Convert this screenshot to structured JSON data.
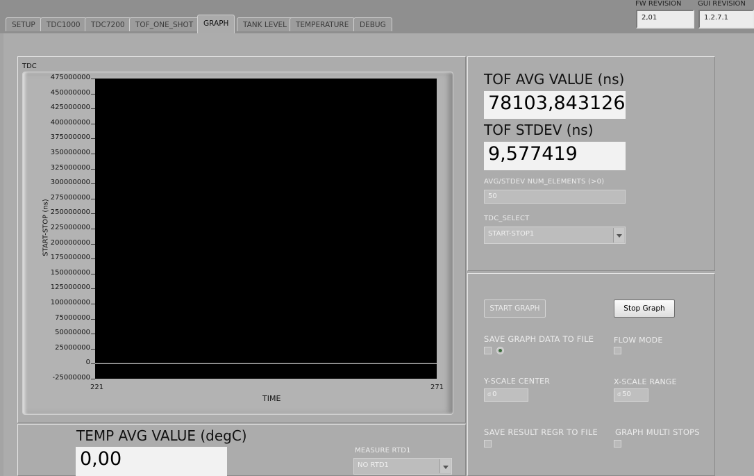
{
  "tabs": [
    {
      "label": "SETUP",
      "active": false
    },
    {
      "label": "TDC1000",
      "active": false
    },
    {
      "label": "TDC7200",
      "active": false
    },
    {
      "label": "TOF_ONE_SHOT",
      "active": false
    },
    {
      "label": "GRAPH",
      "active": true
    },
    {
      "label": "TANK LEVEL",
      "active": false
    },
    {
      "label": "TEMPERATURE",
      "active": false
    },
    {
      "label": "DEBUG",
      "active": false
    }
  ],
  "revisions": {
    "fw_label": "FW REVISION",
    "fw_value": "2,01",
    "gui_label": "GUI REVISION",
    "gui_value": "1.2.7.1"
  },
  "chart_data": {
    "type": "line",
    "title": "TDC",
    "xlabel": "TIME",
    "ylabel": "START-STOP (ns)",
    "xlim": [
      221,
      271
    ],
    "ylim": [
      -25000000,
      475000000
    ],
    "x_ticks": [
      "221",
      "271"
    ],
    "y_ticks": [
      "475000000",
      "450000000",
      "425000000",
      "400000000",
      "375000000",
      "350000000",
      "325000000",
      "300000000",
      "275000000",
      "250000000",
      "225000000",
      "200000000",
      "175000000",
      "150000000",
      "125000000",
      "100000000",
      "75000000",
      "50000000",
      "25000000",
      "0",
      "-25000000"
    ],
    "series": [
      {
        "x": [
          221,
          271
        ],
        "values": [
          78104,
          78104
        ],
        "color": "#ffffff"
      }
    ],
    "background": "#000000",
    "grid": false
  },
  "tof": {
    "avg_label": "TOF AVG VALUE (ns)",
    "avg_value": "78103,843126",
    "stdev_label": "TOF STDEV (ns)",
    "stdev_value": "9,577419",
    "num_elements_label": "AVG/STDEV NUM_ELEMENTS (>0)",
    "num_elements_value": "50",
    "tdc_select_label": "TDC_SELECT",
    "tdc_select_value": "START-STOP1"
  },
  "controls": {
    "start_graph": "START GRAPH",
    "stop_graph": "Stop Graph",
    "save_graph_label": "SAVE GRAPH DATA TO FILE",
    "flow_mode_label": "FLOW MODE",
    "y_scale_center_label": "Y-SCALE CENTER",
    "y_scale_center_value": "0",
    "x_scale_range_label": "X-SCALE RANGE",
    "x_scale_range_value": "50",
    "save_result_label": "SAVE RESULT REGR TO FILE",
    "graph_multi_stops_label": "GRAPH MULTI STOPS"
  },
  "temp": {
    "avg_label": "TEMP AVG VALUE (degC)",
    "avg_value": "0,00",
    "measure_label": "MEASURE RTD1",
    "measure_value": "NO RTD1"
  }
}
